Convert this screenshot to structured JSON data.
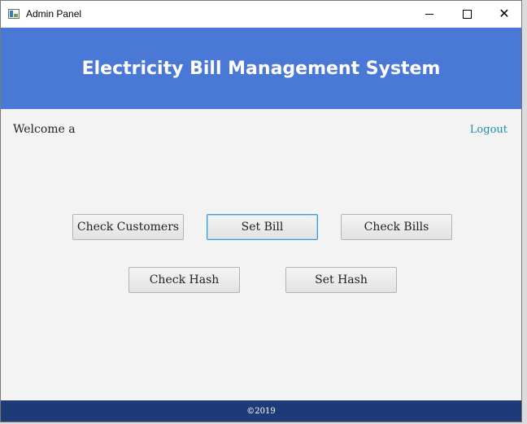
{
  "window": {
    "title": "Admin Panel",
    "minimize_icon": "minimize-icon",
    "maximize_icon": "maximize-icon",
    "close_icon": "close-icon",
    "close_glyph": "✕"
  },
  "header": {
    "title": "Electricity Bill Management System",
    "background": "#4a78d6"
  },
  "welcome_text": "Welcome  a",
  "logout_label": "Logout",
  "buttons": {
    "check_customers": "Check Customers",
    "set_bill": "Set Bill",
    "check_bills": "Check Bills",
    "check_hash": "Check Hash",
    "set_hash": "Set Hash"
  },
  "footer": {
    "text": "©2019",
    "background": "#1f3b77"
  },
  "colors": {
    "link": "#1b8fb5",
    "focus_border": "#3a9ad9",
    "content_bg": "#f3f3f3"
  }
}
